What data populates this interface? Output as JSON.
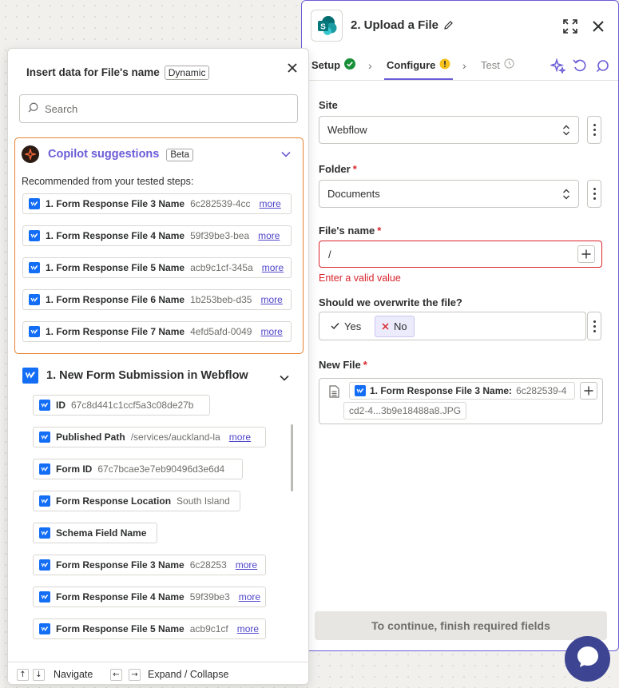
{
  "step": {
    "title": "2. Upload a File",
    "tabs": [
      {
        "label": "Setup",
        "status": "complete"
      },
      {
        "label": "Configure",
        "status": "warning"
      },
      {
        "label": "Test",
        "status": "pending"
      }
    ],
    "fields": {
      "site": {
        "label": "Site",
        "value": "Webflow"
      },
      "folder": {
        "label": "Folder",
        "required_mark": "*",
        "value": "Documents"
      },
      "file_name": {
        "label": "File's name",
        "required_mark": "*",
        "value": "/",
        "error": "Enter a valid value"
      },
      "overwrite": {
        "label": "Should we overwrite the file?",
        "yes": "Yes",
        "no": "No",
        "selected": "No"
      },
      "new_file": {
        "label": "New File",
        "required_mark": "*",
        "pill_key": "1. Form Response File 3 Name:",
        "pill_value": "6c282539-4",
        "pill_continued": "cd2-4...3b9e18488a8.JPG"
      }
    },
    "continue_label": "To continue, finish required fields"
  },
  "insert_panel": {
    "title": "Insert data for File's name",
    "badge": "Dynamic",
    "search_placeholder": "Search",
    "copilot": {
      "title": "Copilot suggestions",
      "badge": "Beta",
      "subtitle": "Recommended from your tested steps:",
      "items": [
        {
          "key": "1. Form Response File 3 Name",
          "value": "6c282539-4cc",
          "more": "more"
        },
        {
          "key": "1. Form Response File 4 Name",
          "value": "59f39be3-bea",
          "more": "more"
        },
        {
          "key": "1. Form Response File 5 Name",
          "value": "acb9c1cf-345a",
          "more": "more"
        },
        {
          "key": "1. Form Response File 6 Name",
          "value": "1b253beb-d35",
          "more": "more"
        },
        {
          "key": "1. Form Response File 7 Name",
          "value": "4efd5afd-0049",
          "more": "more"
        }
      ]
    },
    "group": {
      "title": "1.  New Form Submission in Webflow",
      "items": [
        {
          "key": "ID",
          "value": "67c8d441c1ccf5a3c08de27b",
          "more": ""
        },
        {
          "key": "Published Path",
          "value": "/services/auckland-la",
          "more": "more"
        },
        {
          "key": "Form ID",
          "value": "67c7bcae3e7eb90496d3e6d4",
          "more": ""
        },
        {
          "key": "Form Response Location",
          "value": "South Island",
          "more": ""
        },
        {
          "key": "Schema Field Name",
          "value": "",
          "more": ""
        },
        {
          "key": "Form Response File 3 Name",
          "value": "6c28253",
          "more": "more"
        },
        {
          "key": "Form Response File 4 Name",
          "value": "59f39be3",
          "more": "more"
        },
        {
          "key": "Form Response File 5 Name",
          "value": "acb9c1cf",
          "more": "more"
        }
      ]
    },
    "footer": {
      "navigate": "Navigate",
      "expand": "Expand / Collapse"
    }
  },
  "colors": {
    "accent": "#6a5cd6",
    "error": "#d9242c",
    "copilot_border": "#e8812f",
    "webflow": "#146ef5",
    "chat": "#3d4592"
  }
}
